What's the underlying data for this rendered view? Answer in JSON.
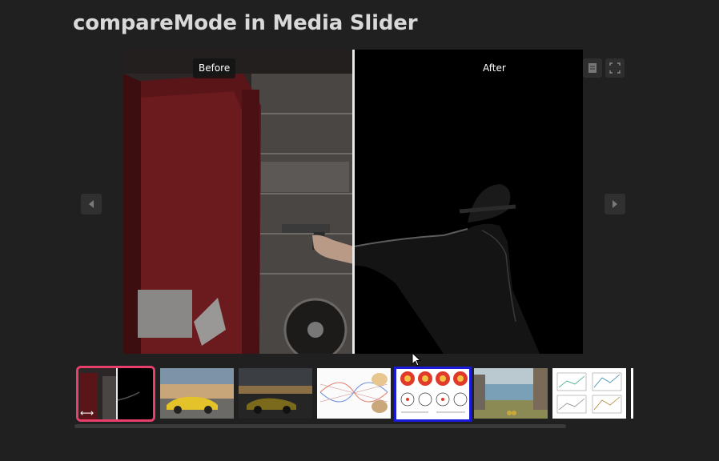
{
  "page": {
    "title": "compareMode in Media Slider"
  },
  "viewer": {
    "before_label": "Before",
    "after_label": "After",
    "top_buttons": [
      "document-icon",
      "fullscreen-icon"
    ],
    "nav": {
      "prev_icon": "chevron-left-icon",
      "next_icon": "chevron-right-icon"
    }
  },
  "thumbnails": [
    {
      "kind": "compare",
      "active": true,
      "overlay_icon": "swap-arrows-icon",
      "overlay_text": "⟷"
    },
    {
      "kind": "photo",
      "subject": "yellow car at sunset"
    },
    {
      "kind": "photo",
      "subject": "yellow car dark edit"
    },
    {
      "kind": "chart",
      "subject": "scientific figure"
    },
    {
      "kind": "chart",
      "subject": "colored polar plots",
      "selected": true
    },
    {
      "kind": "photo",
      "subject": "painting with ruins"
    },
    {
      "kind": "chart",
      "subject": "line graphs figure"
    },
    {
      "kind": "chart",
      "subject": "partial white image"
    }
  ],
  "colors": {
    "background": "#202020",
    "active_thumb_border": "#e83e6c",
    "selected_thumb_border": "#1a1ad9"
  }
}
